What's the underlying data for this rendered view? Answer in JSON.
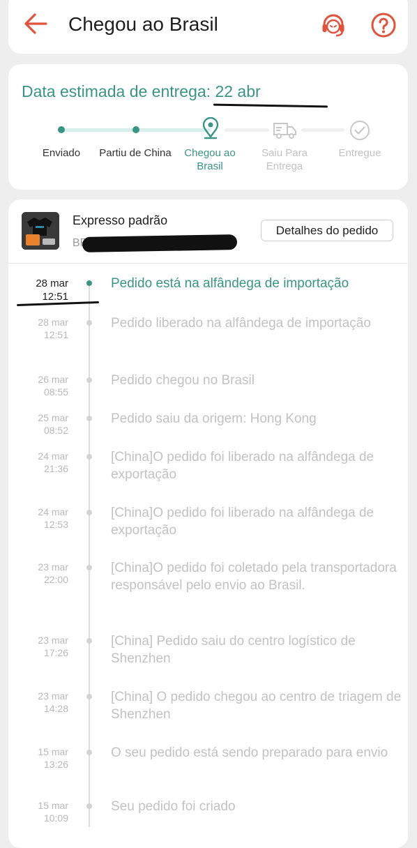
{
  "header": {
    "title": "Chegou ao Brasil"
  },
  "delivery": {
    "estimate": "Data estimada de entrega: 22 abr"
  },
  "steps": [
    {
      "label": "Enviado",
      "state": "done"
    },
    {
      "label": "Partiu de China",
      "state": "done"
    },
    {
      "label": "Chegou ao Brasil",
      "state": "current"
    },
    {
      "label": "Saiu Para Entrega",
      "state": "todo"
    },
    {
      "label": "Entregue",
      "state": "todo"
    }
  ],
  "shipment": {
    "method": "Expresso padrão",
    "tracking_code": "BR",
    "details_button": "Detalhes do pedido"
  },
  "timeline": [
    {
      "date": "28 mar",
      "time": "12:51",
      "text": "Pedido está na alfândega de importação",
      "active": true
    },
    {
      "date": "28 mar",
      "time": "12:51",
      "text": "Pedido liberado na alfândega de importação",
      "active": false
    },
    {
      "date": "26 mar",
      "time": "08:55",
      "text": "Pedido chegou no Brasil",
      "active": false
    },
    {
      "date": "25 mar",
      "time": "08:52",
      "text": "Pedido saiu da origem: Hong Kong",
      "active": false
    },
    {
      "date": "24 mar",
      "time": "21:36",
      "text": "[China]O pedido foi liberado na alfândega de exportação",
      "active": false
    },
    {
      "date": "24 mar",
      "time": "12:53",
      "text": "[China]O pedido foi liberado na alfândega de exportação",
      "active": false
    },
    {
      "date": "23 mar",
      "time": "22:00",
      "text": "[China]O pedido foi coletado pela transportadora responsável pelo envio ao Brasil.",
      "active": false
    },
    {
      "date": "23 mar",
      "time": "17:26",
      "text": "[China] Pedido saiu do centro logístico de Shenzhen",
      "active": false
    },
    {
      "date": "23 mar",
      "time": "14:28",
      "text": "[China] O pedido chegou ao centro de triagem de Shenzhen",
      "active": false
    },
    {
      "date": "15 mar",
      "time": "13:26",
      "text": "O seu pedido está sendo preparado para envio",
      "active": false
    },
    {
      "date": "15 mar",
      "time": "10:09",
      "text": "Seu pedido foi criado",
      "active": false
    }
  ],
  "colors": {
    "accent": "#3a9485",
    "brand_orange": "#e0523c"
  },
  "icons": {
    "back": "arrow-left-icon",
    "support": "headset-icon",
    "help": "question-mark-icon",
    "arrived": "location-pin-icon",
    "out_for_delivery": "truck-icon",
    "delivered": "check-circle-icon"
  }
}
